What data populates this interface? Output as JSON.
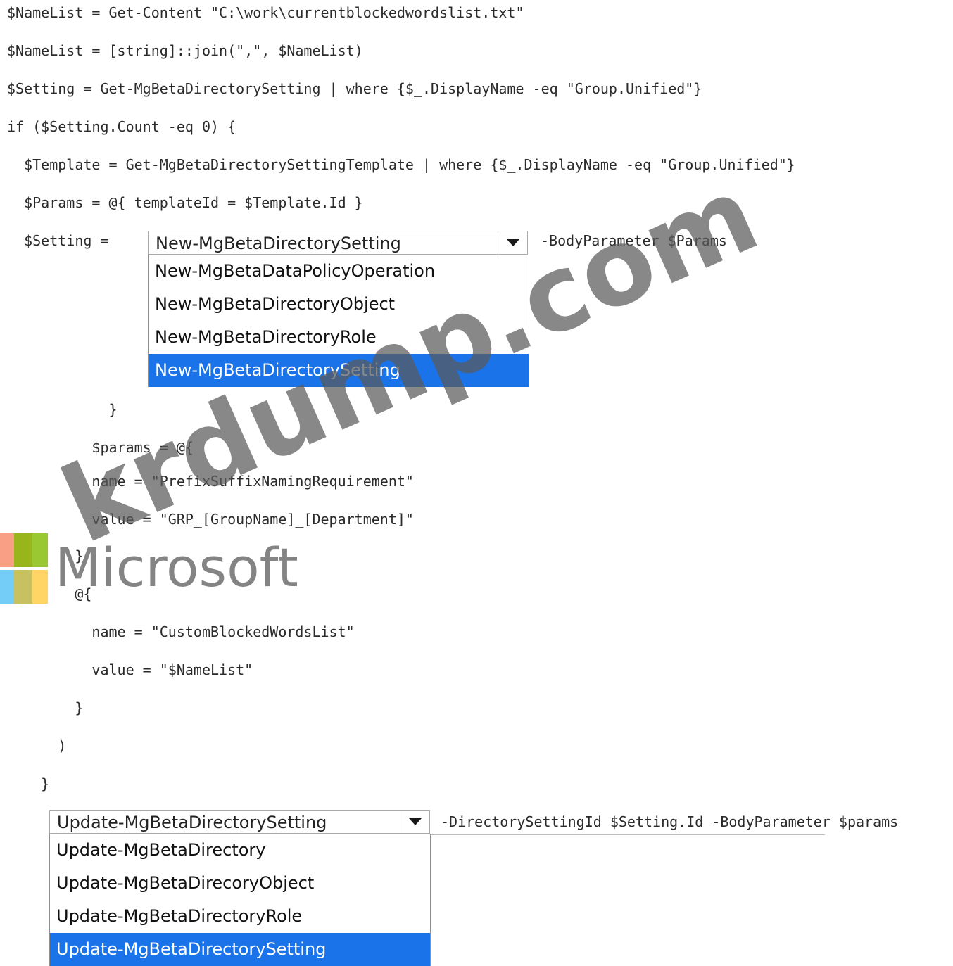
{
  "code": {
    "line1": "$NameList = Get-Content \"C:\\work\\currentblockedwordslist.txt\"",
    "line2": "$NameList = [string]::join(\",\", $NameList)",
    "line3": "$Setting = Get-MgBetaDirectorySetting | where {$_.DisplayName -eq \"Group.Unified\"}",
    "line4": "if ($Setting.Count -eq 0) {",
    "line5": "  $Template = Get-MgBetaDirectorySettingTemplate | where {$_.DisplayName -eq \"Group.Unified\"}",
    "line6": "  $Params = @{ templateId = $Template.Id }",
    "line7_prefix": "  $Setting =",
    "line7_suffix": "-BodyParameter $Params",
    "line8": "            }",
    "line9": "          $params = @{",
    "line10": "          name = \"PrefixSuffixNamingRequirement\"",
    "line11": "          value = \"GRP_[GroupName]_[Department]\"",
    "line12": "        }",
    "line13": "        @{",
    "line14": "          name = \"CustomBlockedWordsList\"",
    "line15": "          value = \"$NameList\"",
    "line16": "        }",
    "line17": "      )",
    "line18": "    }",
    "line19_suffix": "-DirectorySettingId $Setting.Id -BodyParameter $params"
  },
  "dropdown1": {
    "selected": "New-MgBetaDirectorySetting",
    "options": [
      "New-MgBetaDataPolicyOperation",
      "New-MgBetaDirectoryObject",
      "New-MgBetaDirectoryRole",
      "New-MgBetaDirectorySetting"
    ]
  },
  "dropdown2": {
    "selected": "Update-MgBetaDirectorySetting",
    "options": [
      "Update-MgBetaDirectory",
      "Update-MgBetaDirecoryObject",
      "Update-MgBetaDirectoryRole",
      "Update-MgBetaDirectorySetting"
    ]
  },
  "watermark": {
    "text": "krdump.com",
    "logo_text": "Microsoft"
  },
  "colors": {
    "selection": "#1a73e8",
    "logo_red": "#f25022",
    "logo_green": "#7fba00",
    "logo_blue": "#00a4ef",
    "logo_yellow": "#ffb900"
  }
}
